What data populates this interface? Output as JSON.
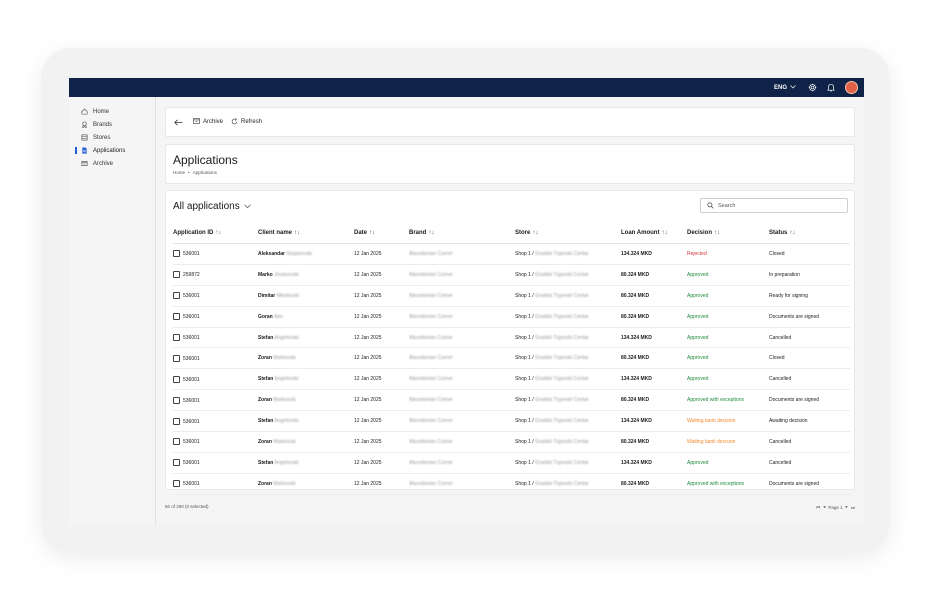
{
  "topbar": {
    "lang": "ENG",
    "icons": [
      "chevron-down-icon",
      "gear-icon",
      "bell-icon",
      "avatar"
    ]
  },
  "sidebar": {
    "items": [
      {
        "label": "Home",
        "icon": "home-icon"
      },
      {
        "label": "Brands",
        "icon": "award-icon"
      },
      {
        "label": "Stores",
        "icon": "store-icon"
      },
      {
        "label": "Applications",
        "icon": "document-icon",
        "active": true
      },
      {
        "label": "Archive",
        "icon": "archive-icon"
      }
    ]
  },
  "toolbar": {
    "archive_label": "Archive",
    "refresh_label": "Refresh"
  },
  "header": {
    "title": "Applications",
    "breadcrumb": [
      "Home",
      "•",
      "Applications"
    ]
  },
  "table_view": {
    "title": "All applications",
    "search_placeholder": "Search"
  },
  "columns": [
    "Application ID",
    "Client name",
    "Date",
    "Brand",
    "Store",
    "Loan Amount",
    "Decision",
    "Status"
  ],
  "sort_glyph": "↑↓",
  "colors": {
    "approved": "#1f8a3b",
    "rejected": "#d13438",
    "waiting": "#f28a30",
    "topbar": "#0f2348"
  },
  "rows": [
    {
      "id": "536001",
      "first": "Aleksandar",
      "last": "Stojanovski",
      "date": "12 Jan 2025",
      "brand": "Macedonian Corner",
      "store_a": "Shop 1 /",
      "store_b": "Gradski Trgovski Centar",
      "amount": "134.324 MKD",
      "decision": "Rejected",
      "decision_type": "rejected",
      "status": "Closed"
    },
    {
      "id": "259872",
      "first": "Marko",
      "last": "Jovanovski",
      "date": "12 Jan 2025",
      "brand": "Macedonian Corner",
      "store_a": "Shop 1 /",
      "store_b": "Gradski Trgovski Centar",
      "amount": "80.324 MKD",
      "decision": "Approved",
      "decision_type": "approved",
      "status": "In preparation"
    },
    {
      "id": "536001",
      "first": "Dimitar",
      "last": "Nikolovski",
      "date": "12 Jan 2025",
      "brand": "Macedonian Corner",
      "store_a": "Shop 1 /",
      "store_b": "Gradski Trgovski Centar",
      "amount": "80.324 MKD",
      "decision": "Approved",
      "decision_type": "approved",
      "status": "Ready for signing"
    },
    {
      "id": "536001",
      "first": "Goran",
      "last": "Iliev",
      "date": "12 Jan 2025",
      "brand": "Macedonian Corner",
      "store_a": "Shop 1 /",
      "store_b": "Gradski Trgovski Centar",
      "amount": "80.324 MKD",
      "decision": "Approved",
      "decision_type": "approved",
      "status": "Documents are signed"
    },
    {
      "id": "536001",
      "first": "Stefan",
      "last": "Angelovski",
      "date": "12 Jan 2025",
      "brand": "Macedonian Corner",
      "store_a": "Shop 1 /",
      "store_b": "Gradski Trgovski Centar",
      "amount": "134.324 MKD",
      "decision": "Approved",
      "decision_type": "approved",
      "status": "Cancelled"
    },
    {
      "id": "536001",
      "first": "Zoran",
      "last": "Markovski",
      "date": "12 Jan 2025",
      "brand": "Macedonian Corner",
      "store_a": "Shop 1 /",
      "store_b": "Gradski Trgovski Centar",
      "amount": "80.324 MKD",
      "decision": "Approved",
      "decision_type": "approved",
      "status": "Closed"
    },
    {
      "id": "536001",
      "first": "Stefan",
      "last": "Angelovski",
      "date": "12 Jan 2025",
      "brand": "Macedonian Corner",
      "store_a": "Shop 1 /",
      "store_b": "Gradski Trgovski Centar",
      "amount": "134.324 MKD",
      "decision": "Approved",
      "decision_type": "approved",
      "status": "Cancelled"
    },
    {
      "id": "536001",
      "first": "Zoran",
      "last": "Markovski",
      "date": "12 Jan 2025",
      "brand": "Macedonian Corner",
      "store_a": "Shop 1 /",
      "store_b": "Gradski Trgovski Centar",
      "amount": "80.324 MKD",
      "decision": "Approved with exceptions",
      "decision_type": "approved",
      "status": "Documents are signed"
    },
    {
      "id": "536001",
      "first": "Stefan",
      "last": "Angelovski",
      "date": "12 Jan 2025",
      "brand": "Macedonian Corner",
      "store_a": "Shop 1 /",
      "store_b": "Gradski Trgovski Centar",
      "amount": "134.324 MKD",
      "decision": "Waiting bank decision",
      "decision_type": "waiting",
      "status": "Awaiting decision"
    },
    {
      "id": "536001",
      "first": "Zoran",
      "last": "Markovski",
      "date": "12 Jan 2025",
      "brand": "Macedonian Corner",
      "store_a": "Shop 1 /",
      "store_b": "Gradski Trgovski Centar",
      "amount": "80.324 MKD",
      "decision": "Waiting bank decision",
      "decision_type": "waiting",
      "status": "Cancelled"
    },
    {
      "id": "536001",
      "first": "Stefan",
      "last": "Angelovski",
      "date": "12 Jan 2025",
      "brand": "Macedonian Corner",
      "store_a": "Shop 1 /",
      "store_b": "Gradski Trgovski Centar",
      "amount": "134.324 MKD",
      "decision": "Approved",
      "decision_type": "approved",
      "status": "Cancelled"
    },
    {
      "id": "536001",
      "first": "Zoran",
      "last": "Markovski",
      "date": "12 Jan 2025",
      "brand": "Macedonian Corner",
      "store_a": "Shop 1 /",
      "store_b": "Gradski Trgovski Centar",
      "amount": "80.324 MKD",
      "decision": "Approved with exceptions",
      "decision_type": "approved",
      "status": "Documents are signed"
    }
  ],
  "footer": {
    "summary": "50 of 250 (0 selected)",
    "page_label": "Page 1"
  }
}
